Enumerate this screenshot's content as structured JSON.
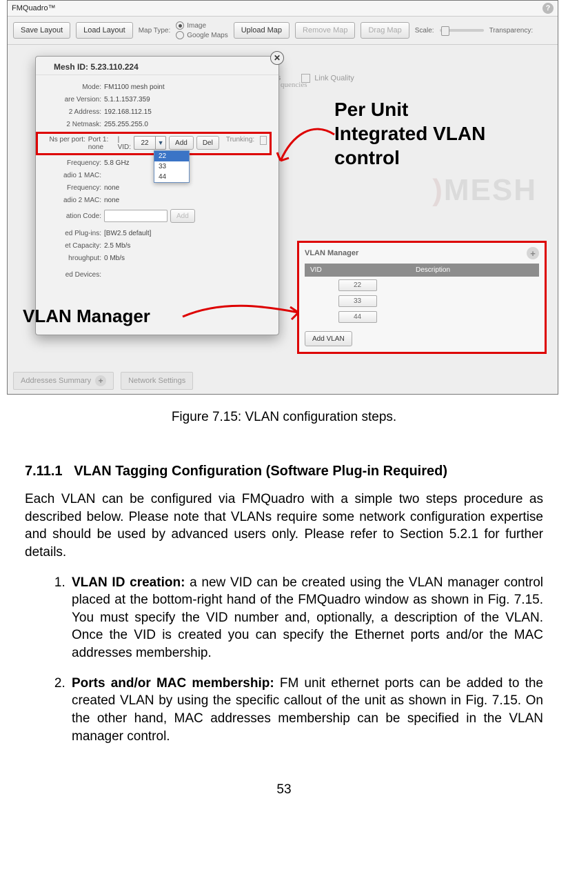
{
  "app": {
    "title": "FMQuadro™",
    "toolbar": {
      "save_layout": "Save Layout",
      "load_layout": "Load Layout",
      "map_type_label": "Map Type:",
      "map_type_image": "Image",
      "map_type_google": "Google Maps",
      "upload_map": "Upload Map",
      "remove_map": "Remove Map",
      "drag_map": "Drag Map",
      "scale_label": "Scale:",
      "transparency_label": "Transparency:"
    }
  },
  "bg_tabs": {
    "hings": "hings",
    "link_quality": "Link Quality",
    "quencies": "quencies"
  },
  "bg_watermark": "MESH",
  "popup": {
    "title": "Mesh ID: 5.23.110.224",
    "rows": {
      "mode_k": "Mode:",
      "mode_v": "FM1100 mesh point",
      "ver_k": "are Version:",
      "ver_v": "5.1.1.1537.359",
      "addr_k": "2 Address:",
      "addr_v": "192.168.112.15",
      "mask_k": "2 Netmask:",
      "mask_v": "255.255.255.0",
      "port_k": "Ns per port:",
      "port_label": "Port 1: none",
      "vid_label": "| VID:",
      "vid_value": "22",
      "add_btn": "Add",
      "del_btn": "Del",
      "trunking_label": "Trunking:",
      "freq1_k": "Frequency:",
      "freq1_v": "5.8 GHz",
      "mac1_k": "adio 1 MAC:",
      "mac1_v": "",
      "freq2_k": "Frequency:",
      "freq2_v": "none",
      "mac2_k": "adio 2 MAC:",
      "mac2_v": "none",
      "act_k": "ation Code:",
      "act_add": "Add",
      "plug_k": "ed Plug-ins:",
      "plug_v": "[BW2.5 default]",
      "cap_k": "et Capacity:",
      "cap_v": "2.5 Mb/s",
      "thr_k": "hroughput:",
      "thr_v": "0 Mb/s",
      "dev_k": "ed Devices:"
    },
    "dropdown": {
      "opt1": "22",
      "opt2": "33",
      "opt3": "44"
    }
  },
  "annotations": {
    "per_unit_l1": "Per Unit",
    "per_unit_l2": "Integrated VLAN",
    "per_unit_l3": "control",
    "vlan_manager": "VLAN Manager"
  },
  "vlan_manager_panel": {
    "title": "VLAN Manager",
    "col_vid": "VID",
    "col_desc": "Description",
    "rows": {
      "r1": "22",
      "r2": "33",
      "r3": "44"
    },
    "add_vlan_btn": "Add VLAN"
  },
  "bottom_tabs": {
    "addr_summary": "Addresses Summary",
    "net_settings": "Network Settings"
  },
  "caption": "Figure 7.15: VLAN configuration steps.",
  "doc": {
    "sec_no": "7.11.1",
    "sec_title": "VLAN Tagging Configuration (Software Plug-in Required)",
    "intro": "Each VLAN can be configured via FMQuadro with a simple two steps procedure as described below. Please note that VLANs require some network configuration expertise and should be used by advanced users only. Please refer to Section 5.2.1 for further details.",
    "step1_title": "VLAN ID creation:",
    "step1_body": " a new VID can be created using the VLAN manager control placed at the bottom-right hand of the FMQuadro window as shown in Fig. 7.15.  You must specify the VID number and, optionally, a description of the VLAN. Once the VID is created you can specify the Ethernet ports and/or the MAC addresses membership.",
    "step2_title": "Ports and/or MAC membership:",
    "step2_body": "  FM unit ethernet ports can be added to the created VLAN by using the specific callout of the unit as shown in Fig. 7.15. On the other hand, MAC addresses membership can be specified in the VLAN manager control.",
    "page_number": "53"
  }
}
